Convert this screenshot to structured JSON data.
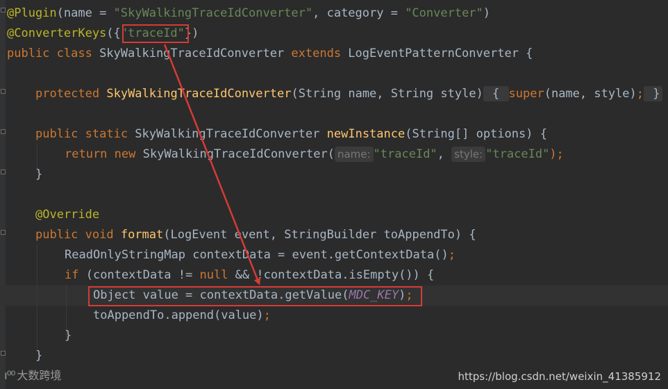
{
  "code": {
    "l1": {
      "ann": "@Plugin",
      "open": "(name = ",
      "name": "\"SkyWalkingTraceIdConverter\"",
      "mid": ", category = ",
      "category": "\"Converter\"",
      "close": ")"
    },
    "l2": {
      "ann": "@ConverterKeys",
      "open": "({",
      "key": "\"traceId\"",
      "close": "})"
    },
    "l3": {
      "kw": "public class ",
      "cls": "SkyWalkingTraceIdConverter ",
      "ext": "extends ",
      "parent": "LogEventPatternConverter {"
    },
    "l5": {
      "kw": "protected ",
      "fn": "SkyWalkingTraceIdConverter",
      "params": "(String name, String style)",
      "fold_open": " { ",
      "super": "super",
      "args": "(name, style)",
      "semi": ";",
      "fold_close": " }"
    },
    "l7": {
      "kw": "public static ",
      "cls": "SkyWalkingTraceIdConverter ",
      "fn": "newInstance",
      "params": "(String[] options) {"
    },
    "l8": {
      "kw_return": "return ",
      "kw_new": "new ",
      "cls": "SkyWalkingTraceIdConverter(",
      "hint_name": "name:",
      "val1": "\"traceId\"",
      "comma": ", ",
      "hint_style": "style:",
      "val2": "\"traceId\"",
      "end": ");"
    },
    "l9": {
      "text": "}"
    },
    "l11": {
      "ann": "@Override"
    },
    "l12": {
      "kw": "public void ",
      "fn": "format",
      "params": "(LogEvent event, StringBuilder toAppendTo) {"
    },
    "l13": {
      "text": "ReadOnlyStringMap contextData = event.getContextData()",
      "semi": ";"
    },
    "l14": {
      "kw_if": "if ",
      "a": "(contextData != ",
      "kw_null": "null",
      "b": " && !contextData.isEmpty()) {"
    },
    "l15": {
      "a": "Object value = contextData.getValue(",
      "konst": "MDC_KEY",
      "b": ")",
      "semi": ";"
    },
    "l16": {
      "text": "toAppendTo.append(value)",
      "semi": ";"
    },
    "l17": {
      "text": "}"
    },
    "l18": {
      "text": "}"
    }
  },
  "watermark": {
    "logo_glyph": "ı⁰⁰",
    "logo_text": "大数跨境",
    "url": "https://blog.csdn.net/weixin_41385912"
  },
  "colors": {
    "background": "#2b2b2b",
    "keyword": "#cc7832",
    "string": "#6a8759",
    "annotation": "#bbb529",
    "function": "#ffc66d",
    "constant": "#9876aa",
    "highlight_box": "#d63b36"
  }
}
